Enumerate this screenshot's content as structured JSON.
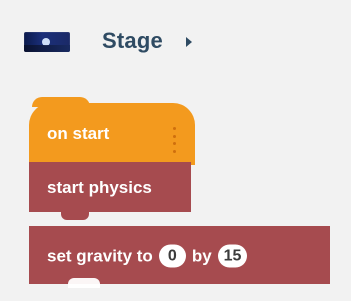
{
  "header": {
    "title": "Stage",
    "thumbnail_icon": "stage-thumbnail-image",
    "chevron_icon": "chevron-right-icon"
  },
  "blocks": {
    "on_start": {
      "label": "on start",
      "drag_icon": "drag-handle-icon"
    },
    "start_physics": {
      "label": "start physics"
    },
    "set_gravity": {
      "prefix": "set gravity to",
      "x_value": "0",
      "between": "by",
      "y_value": "15"
    }
  },
  "colors": {
    "background": "#f2f2f2",
    "title": "#2f4b63",
    "orange_block": "#f39a1e",
    "physics_block": "#a64b4f",
    "pill_bg": "#ffffff",
    "pill_text": "#3b3b3b"
  }
}
